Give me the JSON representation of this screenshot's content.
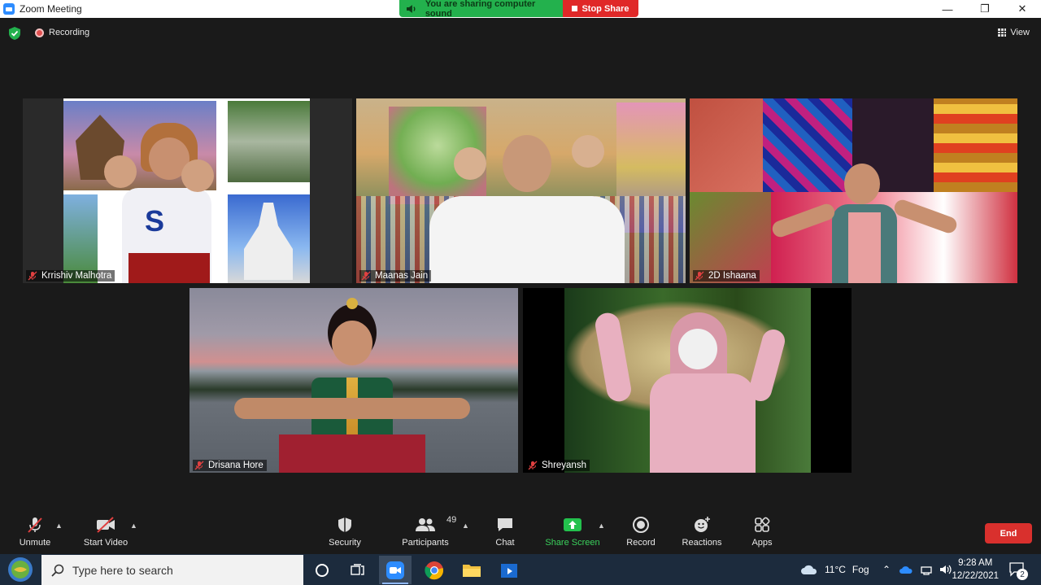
{
  "window": {
    "title": "Zoom Meeting"
  },
  "share_banner": {
    "sound_text": "You are sharing computer sound",
    "stop_label": "Stop Share"
  },
  "meeting_bar": {
    "recording_label": "Recording",
    "view_label": "View"
  },
  "participants": [
    {
      "name": "Krrishiv Malhotra",
      "muted": true
    },
    {
      "name": "Maanas Jain",
      "muted": true
    },
    {
      "name": "2D Ishaana",
      "muted": true
    },
    {
      "name": "Drisana Hore",
      "muted": true
    },
    {
      "name": "Shreyansh",
      "muted": true
    }
  ],
  "toolbar": {
    "unmute": "Unmute",
    "start_video": "Start Video",
    "security": "Security",
    "participants": "Participants",
    "participants_count": "49",
    "chat": "Chat",
    "share_screen": "Share Screen",
    "record": "Record",
    "reactions": "Reactions",
    "apps": "Apps",
    "end": "End"
  },
  "taskbar": {
    "search_placeholder": "Type here to search",
    "weather_temp": "11°C",
    "weather_cond": "Fog",
    "time": "9:28 AM",
    "date": "12/22/2021",
    "notification_count": "2"
  },
  "colors": {
    "accent_green": "#23b14d",
    "stop_red": "#e02828",
    "end_red": "#d9302d",
    "zoom_blue": "#2d8cff"
  }
}
